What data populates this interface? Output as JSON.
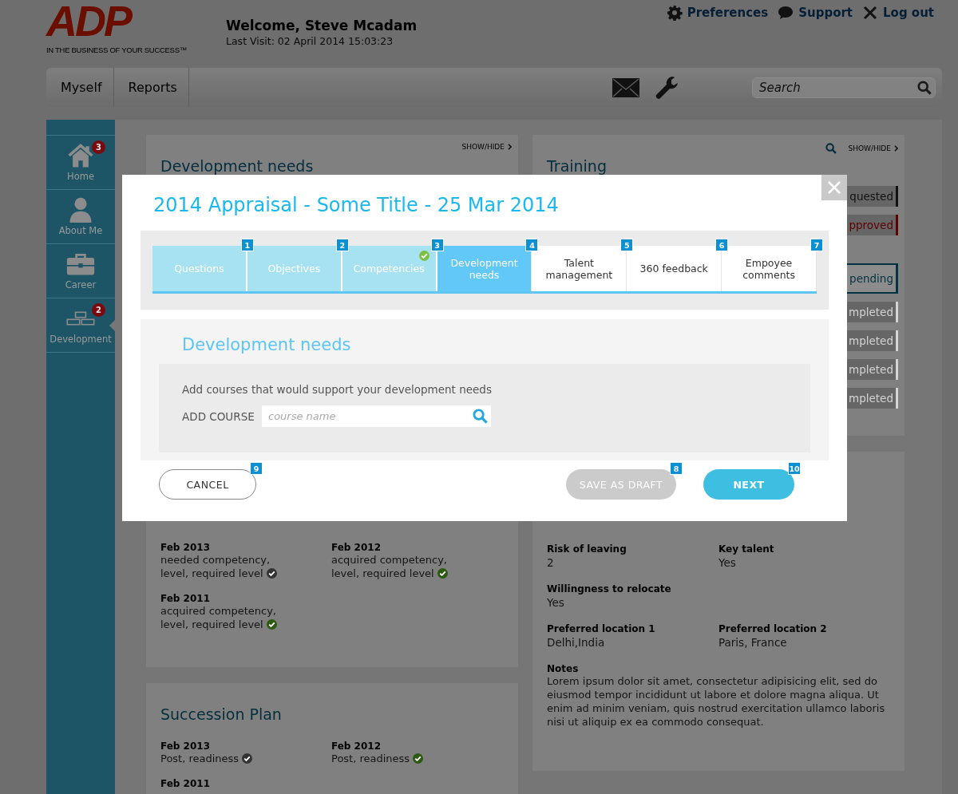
{
  "header": {
    "logo": "ADP",
    "tagline": "IN THE BUSINESS OF YOUR SUCCESS™",
    "welcome": "Welcome, Steve Mcadam",
    "last_visit": "Last Visit: 02 April 2014 15:03:23",
    "links": [
      {
        "label": "Preferences",
        "kind": "gear"
      },
      {
        "label": "Support",
        "kind": "chat"
      },
      {
        "label": "Log out",
        "kind": "close"
      }
    ]
  },
  "nav": {
    "tabs": [
      {
        "label": "Myself"
      },
      {
        "label": "Reports"
      }
    ],
    "tools": [
      {
        "kind": "mail"
      },
      {
        "kind": "wrench"
      }
    ],
    "search": {
      "placeholder": "Search"
    }
  },
  "sidebar": {
    "items": [
      {
        "label": "Home",
        "kind": "home",
        "badge": "3",
        "selected": false
      },
      {
        "label": "About Me",
        "kind": "person",
        "selected": false
      },
      {
        "label": "Career",
        "kind": "briefcase",
        "selected": false
      },
      {
        "label": "Development",
        "kind": "blocks",
        "badge": "2",
        "selected": true
      }
    ]
  },
  "development_card": {
    "title": "Development needs",
    "show_hide": "SHOW/HIDE"
  },
  "competencies_card": {
    "items": [
      {
        "date": "Feb 2013",
        "text": "needed competency, level, required level",
        "color": "#333333"
      },
      {
        "date": "Feb 2012",
        "text": "acquired competency, level, required level",
        "color": "#2c5a10"
      },
      {
        "date": "Feb 2011",
        "text": "acquired competency, level, required level",
        "color": "#2c5a10"
      }
    ]
  },
  "succession_card": {
    "title": "Succession Plan",
    "items": [
      {
        "date": "Feb 2013",
        "text": "Post, readiness",
        "color": "#333333"
      },
      {
        "date": "Feb 2012",
        "text": "Post, readiness",
        "color": "#2c5a10"
      },
      {
        "date": "Feb 2011"
      }
    ]
  },
  "training_card": {
    "title": "Training",
    "show_hide": "SHOW/HIDE",
    "statuses": [
      {
        "label": "quested",
        "color": "#111111",
        "kind": "plain"
      },
      {
        "label": "pproved",
        "color": "#5c0000",
        "kind": "plain"
      },
      {
        "label": "pending",
        "color": "#053242",
        "kind": "boxed"
      },
      {
        "label": "mpleted",
        "color": "#d4d4d4",
        "kind": "plain"
      },
      {
        "label": "mpleted",
        "color": "#d4d4d4",
        "kind": "plain"
      },
      {
        "label": "mpleted",
        "color": "#d4d4d4",
        "kind": "plain"
      },
      {
        "label": "mpleted",
        "color": "#d4d4d4",
        "kind": "plain"
      }
    ]
  },
  "profile_card": {
    "rows": [
      [
        {
          "label": "Risk of leaving",
          "value": "2"
        },
        {
          "label": "Key talent",
          "value": "Yes"
        }
      ],
      [
        {
          "label": "Willingness to relocate",
          "value": "Yes"
        }
      ],
      [
        {
          "label": "Preferred location 1",
          "value": "Delhi,India"
        },
        {
          "label": "Preferred location 2",
          "value": "Paris, France"
        }
      ]
    ],
    "notes": {
      "label": "Notes",
      "text": "Lorem ipsum dolor sit amet, consectetur adipisicing elit, sed do eiusmod tempor incididunt ut labore et dolore magna aliqua. Ut enim ad minim veniam, quis nostrud exercitation ullamco laboris nisi ut aliquip ex ea commodo consequat."
    }
  },
  "modal": {
    "title": "2014 Appraisal - Some Title - 25 Mar 2014",
    "steps": [
      {
        "number": "1",
        "label": "Questions",
        "completed": true,
        "selected": false,
        "checked": false
      },
      {
        "number": "2",
        "label": "Objectives",
        "completed": true,
        "selected": false,
        "checked": false
      },
      {
        "number": "3",
        "label": "Competencies",
        "completed": true,
        "selected": false,
        "checked": true
      },
      {
        "number": "4",
        "label": "Development needs",
        "completed": false,
        "selected": true,
        "checked": false
      },
      {
        "number": "5",
        "label": "Talent management",
        "completed": false,
        "selected": false,
        "checked": false
      },
      {
        "number": "6",
        "label": "360 feedback",
        "completed": false,
        "selected": false,
        "checked": false
      },
      {
        "number": "7",
        "label": "Empoyee comments",
        "completed": false,
        "selected": false,
        "checked": false
      }
    ],
    "section": {
      "heading": "Development needs",
      "prompt": "Add courses that would support your development needs",
      "field": {
        "label": "ADD COURSE",
        "placeholder": "course name"
      }
    },
    "buttons": [
      {
        "label": "CANCEL",
        "number": "9",
        "kind": "outline"
      },
      {
        "label": "SAVE AS DRAFT",
        "number": "8",
        "kind": "muted"
      },
      {
        "label": "NEXT",
        "number": "10",
        "kind": "primary"
      }
    ]
  }
}
